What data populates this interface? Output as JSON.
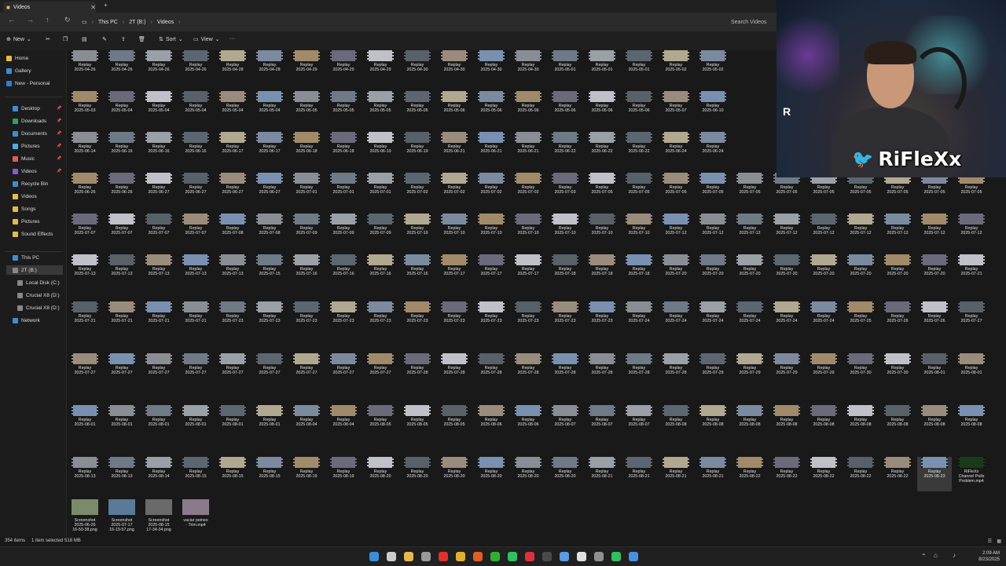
{
  "window": {
    "tab_title": "Videos",
    "new_tab": "+"
  },
  "address": {
    "breadcrumb": [
      "This PC",
      "2T (B:)",
      "Videos"
    ],
    "search_placeholder": "Search Videos"
  },
  "toolbar": {
    "new_label": "New",
    "sort_label": "Sort",
    "view_label": "View",
    "more": "···"
  },
  "sidebar": {
    "quick": [
      "Home",
      "Gallery",
      "New - Personal"
    ],
    "pinned": [
      "Desktop",
      "Downloads",
      "Documents",
      "Pictures",
      "Music",
      "Videos",
      "Recycle Bin",
      "Videos",
      "Songs",
      "Pictures",
      "Sound Effects"
    ],
    "devices": [
      "This PC",
      "2T (B:)",
      "Local Disk (C:)",
      "Crucial X8 (D:)",
      "Crucial X8 (D:)",
      "Network"
    ]
  },
  "rows": [
    {
      "type": "Replay",
      "dates": [
        "2025-04-26",
        "2025-04-26",
        "2025-04-26",
        "2025-04-26",
        "2025-04-28",
        "2025-04-28",
        "2025-04-29",
        "2025-04-29",
        "2025-04-29",
        "2025-04-30",
        "2025-04-30",
        "2025-04-30",
        "2025-04-30",
        "2025-05-01",
        "2025-05-01",
        "2025-05-01",
        "2025-05-02",
        "2025-05-02"
      ]
    },
    {
      "type": "Replay",
      "dates": [
        "2025-05-03",
        "2025-05-04",
        "2025-05-04",
        "2025-05-04",
        "2025-05-04",
        "2025-05-04",
        "2025-05-05",
        "2025-05-05",
        "2025-05-05",
        "2025-05-05",
        "2025-05-06",
        "2025-05-06",
        "2025-05-06",
        "2025-05-06",
        "2025-05-06",
        "2025-05-06",
        "2025-05-07",
        "2025-06-10"
      ]
    },
    {
      "type": "Replay",
      "dates": [
        "2025-06-14",
        "2025-06-16",
        "2025-06-16",
        "2025-06-16",
        "2025-06-17",
        "2025-06-17",
        "2025-06-18",
        "2025-06-18",
        "2025-06-19",
        "2025-06-19",
        "2025-06-21",
        "2025-06-21",
        "2025-06-21",
        "2025-06-22",
        "2025-06-22",
        "2025-06-22",
        "2025-06-24",
        "2025-06-24"
      ]
    },
    {
      "type": "Replay",
      "dates": [
        "2025-06-26",
        "2025-06-26",
        "2025-06-27",
        "2025-06-27",
        "2025-06-27",
        "2025-06-27",
        "2025-07-01",
        "2025-07-01",
        "2025-07-01",
        "2025-07-02",
        "2025-07-02",
        "2025-07-02",
        "2025-07-02",
        "2025-07-03",
        "2025-07-05",
        "2025-07-05",
        "2025-07-05",
        "2025-07-05",
        "2025-07-05",
        "2025-07-05",
        "2025-07-05",
        "2025-07-05",
        "2025-07-05",
        "2025-07-05",
        "2025-07-05"
      ]
    },
    {
      "type": "Replay",
      "dates": [
        "2025-07-07",
        "2025-07-07",
        "2025-07-07",
        "2025-07-07",
        "2025-07-08",
        "2025-07-08",
        "2025-07-09",
        "2025-07-09",
        "2025-07-09",
        "2025-07-10",
        "2025-07-10",
        "2025-07-10",
        "2025-07-10",
        "2025-07-10",
        "2025-07-10",
        "2025-07-10",
        "2025-07-12",
        "2025-07-12",
        "2025-07-12",
        "2025-07-12",
        "2025-07-12",
        "2025-07-12",
        "2025-07-12",
        "2025-07-12",
        "2025-07-12",
        "2025-07-12"
      ]
    },
    {
      "type": "Replay",
      "dates": [
        "2025-07-13",
        "2025-07-13",
        "2025-07-13",
        "2025-07-13",
        "2025-07-13",
        "2025-07-15",
        "2025-07-16",
        "2025-07-16",
        "2025-07-16",
        "2025-07-16",
        "2025-07-17",
        "2025-07-17",
        "2025-07-17",
        "2025-07-18",
        "2025-07-18",
        "2025-07-18",
        "2025-07-20",
        "2025-07-20",
        "2025-07-20",
        "2025-07-20",
        "2025-07-20",
        "2025-07-20",
        "2025-07-20",
        "2025-07-20",
        "2025-07-21",
        "2025-07-21"
      ]
    },
    {
      "type": "Replay",
      "dates": [
        "2025-07-21",
        "2025-07-21",
        "2025-07-21",
        "2025-07-21",
        "2025-07-23",
        "2025-07-23",
        "2025-07-23",
        "2025-07-23",
        "2025-07-23",
        "2025-07-23",
        "2025-07-23",
        "2025-07-23",
        "2025-07-23",
        "2025-07-23",
        "2025-07-23",
        "2025-07-24",
        "2025-07-24",
        "2025-07-24",
        "2025-07-24",
        "2025-07-24",
        "2025-07-24",
        "2025-07-25",
        "2025-07-26",
        "2025-07-26",
        "2025-07-27",
        "2025-07-27"
      ]
    },
    {
      "type": "Replay",
      "dates": [
        "2025-07-27",
        "2025-07-27",
        "2025-07-27",
        "2025-07-27",
        "2025-07-27",
        "2025-07-27",
        "2025-07-27",
        "2025-07-27",
        "2025-07-27",
        "2025-07-28",
        "2025-07-28",
        "2025-07-28",
        "2025-07-28",
        "2025-07-28",
        "2025-07-28",
        "2025-07-28",
        "2025-07-28",
        "2025-07-29",
        "2025-07-29",
        "2025-07-29",
        "2025-07-29",
        "2025-07-30",
        "2025-07-30",
        "2025-08-01",
        "2025-08-01",
        "2025-08-01"
      ]
    },
    {
      "type": "Replay",
      "dates": [
        "2025-08-01",
        "2025-08-01",
        "2025-08-01",
        "2025-08-01",
        "2025-08-01",
        "2025-08-01",
        "2025-08-04",
        "2025-08-04",
        "2025-08-05",
        "2025-08-05",
        "2025-08-05",
        "2025-08-06",
        "2025-08-06",
        "2025-08-07",
        "2025-08-07",
        "2025-08-07",
        "2025-08-08",
        "2025-08-08",
        "2025-08-08",
        "2025-08-08",
        "2025-08-08",
        "2025-08-08",
        "2025-08-08",
        "2025-08-08",
        "2025-08-08",
        "2025-08-12"
      ]
    },
    {
      "type": "Replay",
      "dates": [
        "2025-08-13",
        "2025-08-13",
        "2025-08-14",
        "2025-08-15",
        "2025-08-15",
        "2025-08-15",
        "2025-08-19",
        "2025-08-19",
        "2025-08-20",
        "2025-08-20",
        "2025-08-20",
        "2025-08-20",
        "2025-08-20",
        "2025-08-20",
        "2025-08-21",
        "2025-08-21",
        "2025-08-21",
        "2025-08-21",
        "2025-08-22",
        "2025-08-22",
        "2025-08-22",
        "2025-08-22",
        "2025-08-22",
        "2025-08-23"
      ]
    },
    {
      "type": "Screenshot",
      "dates": []
    }
  ],
  "row9_extra": {
    "name": "RiFleXx",
    "lines": [
      "Channel Polls",
      "Problem.mp4"
    ]
  },
  "last_row": [
    {
      "name": "Screenshot",
      "date": "2025-06-26",
      "sub": "16-50-38.png"
    },
    {
      "name": "Screenshot",
      "date": "2025-07-17",
      "sub": "16-19-57.png"
    },
    {
      "name": "Screenshot",
      "date": "2025-08-15",
      "sub": "17-34-34.png"
    },
    {
      "name": "vaciar peines",
      "date": "- Trim.mp4",
      "sub": ""
    }
  ],
  "status": {
    "items": "354 items",
    "selected": "1 item selected  518 MB"
  },
  "clock": {
    "time": "2:09 AM",
    "date": "8/23/2025"
  },
  "overlay": {
    "handle": "RiFleXx",
    "badge": "R"
  },
  "colors": {
    "accent": "#3aa0ff",
    "bg": "#191919",
    "sidebar_selected": "#393939"
  }
}
